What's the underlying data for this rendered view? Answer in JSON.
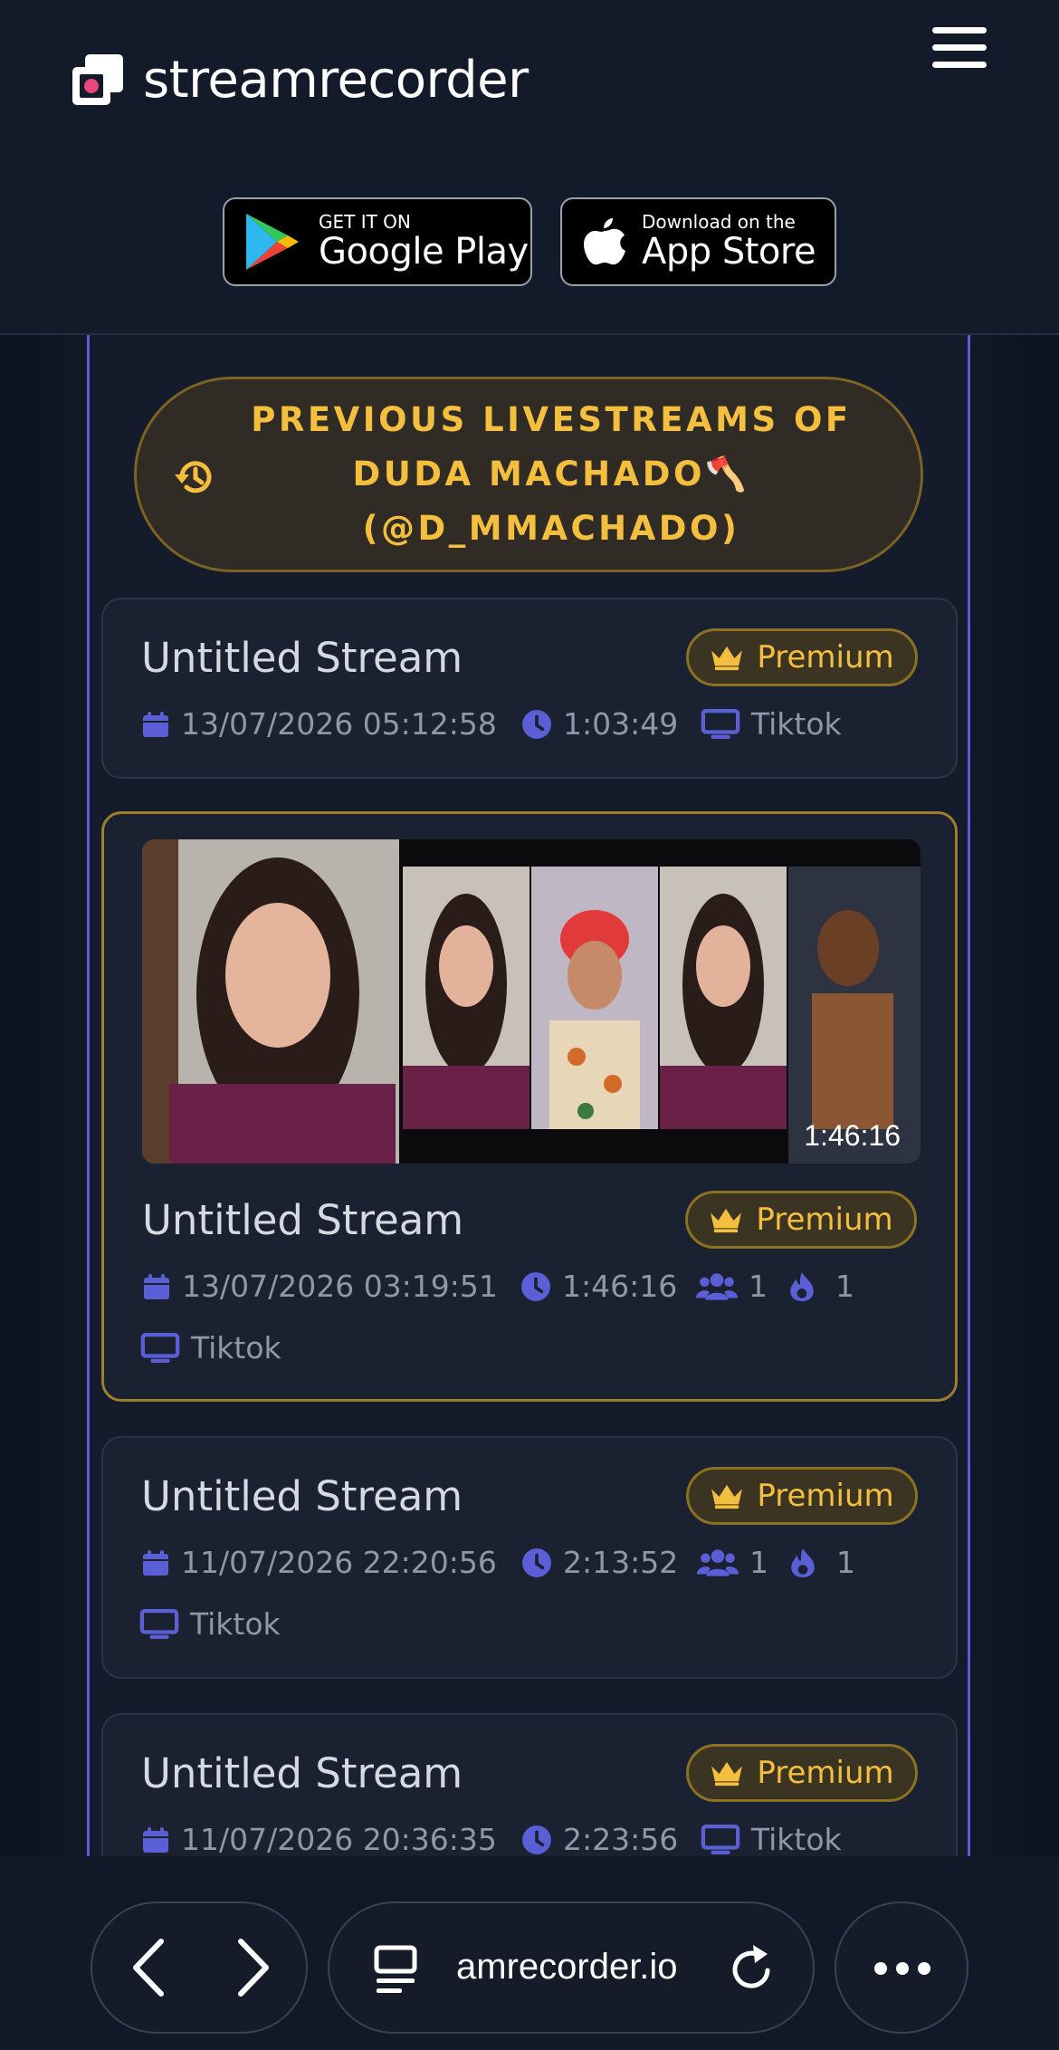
{
  "header": {
    "logo_text": "streamrecorder",
    "google_play": {
      "small": "GET IT ON",
      "big": "Google Play"
    },
    "app_store": {
      "small": "Download on the",
      "big": "App Store"
    }
  },
  "heading": {
    "line1": "PREVIOUS LIVESTREAMS OF",
    "line2": "DUDA MACHADO🪓",
    "line3": "(@D_MMACHADO)"
  },
  "streams": [
    {
      "title": "Untitled Stream",
      "badge": "Premium",
      "date": "13/07/2026 05:12:58",
      "duration": "1:03:49",
      "platform": "Tiktok"
    },
    {
      "title": "Untitled Stream",
      "badge": "Premium",
      "date": "13/07/2026 03:19:51",
      "duration": "1:46:16",
      "viewers": "1",
      "likes": "1",
      "platform": "Tiktok",
      "thumbnail_duration": "1:46:16"
    },
    {
      "title": "Untitled Stream",
      "badge": "Premium",
      "date": "11/07/2026 22:20:56",
      "duration": "2:13:52",
      "viewers": "1",
      "likes": "1",
      "platform": "Tiktok"
    },
    {
      "title": "Untitled Stream",
      "badge": "Premium",
      "date": "11/07/2026 20:36:35",
      "duration": "2:23:56",
      "platform": "Tiktok"
    }
  ],
  "browser": {
    "url": "amrecorder.io"
  },
  "colors": {
    "accent": "#f4bf3f",
    "brand_indigo": "#5b5fd6",
    "logo_pink": "#e8467c"
  }
}
